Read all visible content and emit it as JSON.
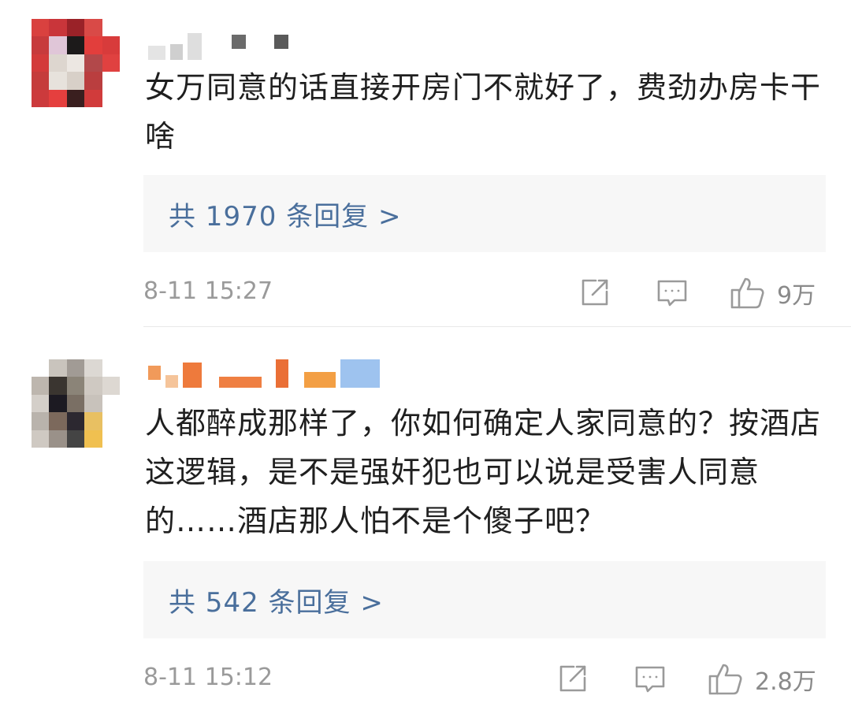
{
  "comments": [
    {
      "text": "女万同意的话直接开房门不就好了，费劲办房卡干啥",
      "replies_label": "共 1970 条回复 >",
      "time": "8-11 15:27",
      "likes": "9万"
    },
    {
      "text": "人都醉成那样了，你如何确定人家同意的？按酒店这逻辑，是不是强奸犯也可以说是受害人同意的……酒店那人怕不是个傻子吧？",
      "replies_label": "共 542 条回复 >",
      "time": "8-11 15:12",
      "likes": "2.8万"
    }
  ],
  "icons": {
    "share": "share-icon",
    "comment": "comment-icon",
    "like": "thumbs-up-icon"
  },
  "colors": {
    "reply_link": "#4a6f9c",
    "reply_bg": "#f7f7f7",
    "meta_text": "#9a9a9a"
  }
}
